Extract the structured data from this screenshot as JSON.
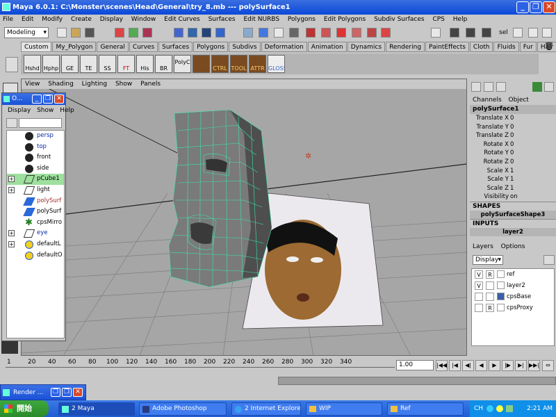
{
  "window": {
    "title": "Maya 6.0.1: C:\\Monster\\scenes\\Head\\General\\try_8.mb   ---   polySurface1",
    "minimize": "_",
    "maximize": "❐",
    "close": "✕"
  },
  "menubar": [
    "File",
    "Edit",
    "Modify",
    "Create",
    "Display",
    "Window",
    "Edit Curves",
    "Surfaces",
    "Edit NURBS",
    "Polygons",
    "Edit Polygons",
    "Subdiv Surfaces",
    "CPS",
    "Help"
  ],
  "statusline": {
    "mode": "Modeling",
    "sel_label": "sel"
  },
  "shelf_tabs": [
    "Custom",
    "My_Polygon",
    "General",
    "Curves",
    "Surfaces",
    "Polygons",
    "Subdivs",
    "Deformation",
    "Animation",
    "Dynamics",
    "Rendering",
    "PaintEffects",
    "Cloth",
    "Fluids",
    "Fur",
    "Hair"
  ],
  "shelf_buttons": [
    "Hshd",
    "Hphp",
    "GE",
    "TE",
    "SS",
    "FT",
    "His",
    "BR",
    "PolyC",
    "",
    "CTRL",
    "TOOL",
    "ATTR",
    "GLOSS"
  ],
  "viewport": {
    "menu": [
      "View",
      "Shading",
      "Lighting",
      "Show",
      "Panels"
    ]
  },
  "outliner": {
    "title": "O...",
    "menu": [
      "Display",
      "Show",
      "Help"
    ],
    "items": [
      {
        "label": "persp",
        "icon": "camera-icon",
        "expand": ""
      },
      {
        "label": "top",
        "icon": "camera-icon",
        "expand": ""
      },
      {
        "label": "front",
        "icon": "camera-icon",
        "expand": ""
      },
      {
        "label": "side",
        "icon": "camera-icon",
        "expand": ""
      },
      {
        "label": "pCube1",
        "icon": "transform-icon",
        "expand": "+",
        "selected": true
      },
      {
        "label": "light",
        "icon": "transform-icon",
        "expand": "+"
      },
      {
        "label": "polySurf",
        "icon": "poly-mesh-icon",
        "expand": ""
      },
      {
        "label": "polySurf",
        "icon": "poly-mesh-icon",
        "expand": ""
      },
      {
        "label": "cpsMirro",
        "icon": "cps-icon",
        "expand": ""
      },
      {
        "label": "eye",
        "icon": "transform-icon",
        "expand": "+"
      },
      {
        "label": "defaultL",
        "icon": "light-set-icon",
        "expand": "+"
      },
      {
        "label": "defaultO",
        "icon": "object-set-icon",
        "expand": ""
      }
    ]
  },
  "channel_box": {
    "tabs": [
      "Channels",
      "Object"
    ],
    "object": "polySurface1",
    "attributes": [
      {
        "name": "Translate X",
        "value": "0"
      },
      {
        "name": "Translate Y",
        "value": "0"
      },
      {
        "name": "Translate Z",
        "value": "0"
      },
      {
        "name": "Rotate X",
        "value": "0"
      },
      {
        "name": "Rotate Y",
        "value": "0"
      },
      {
        "name": "Rotate Z",
        "value": "0"
      },
      {
        "name": "Scale X",
        "value": "1"
      },
      {
        "name": "Scale Y",
        "value": "1"
      },
      {
        "name": "Scale Z",
        "value": "1"
      },
      {
        "name": "Visibility",
        "value": "on"
      }
    ],
    "shapes_label": "SHAPES",
    "shape": "polySurfaceShape3",
    "inputs_label": "INPUTS",
    "input": "layer2"
  },
  "layers": {
    "menu": [
      "Layers",
      "Options"
    ],
    "display": "Display",
    "items": [
      {
        "v": "V",
        "r": "R",
        "color": "",
        "name": "ref"
      },
      {
        "v": "V",
        "r": "",
        "color": "",
        "name": "layer2"
      },
      {
        "v": "",
        "r": "",
        "color": "#3a5fa8",
        "name": "cpsBase"
      },
      {
        "v": "",
        "r": "R",
        "color": "",
        "name": "cpsProxy"
      }
    ]
  },
  "timeline": {
    "ticks": [
      "1",
      "20",
      "40",
      "60",
      "80",
      "100",
      "120",
      "140",
      "160",
      "180",
      "200",
      "220",
      "240",
      "260",
      "280",
      "300",
      "320",
      "340"
    ],
    "current": "1.00"
  },
  "render_window": {
    "title": "Render ..."
  },
  "taskbar": {
    "start": "開始",
    "tasks": [
      "2 Maya",
      "Adobe Photoshop",
      "2 Internet Explorer",
      "WIP",
      "Ref"
    ],
    "lang": "CH",
    "clock": "2:21 AM"
  }
}
